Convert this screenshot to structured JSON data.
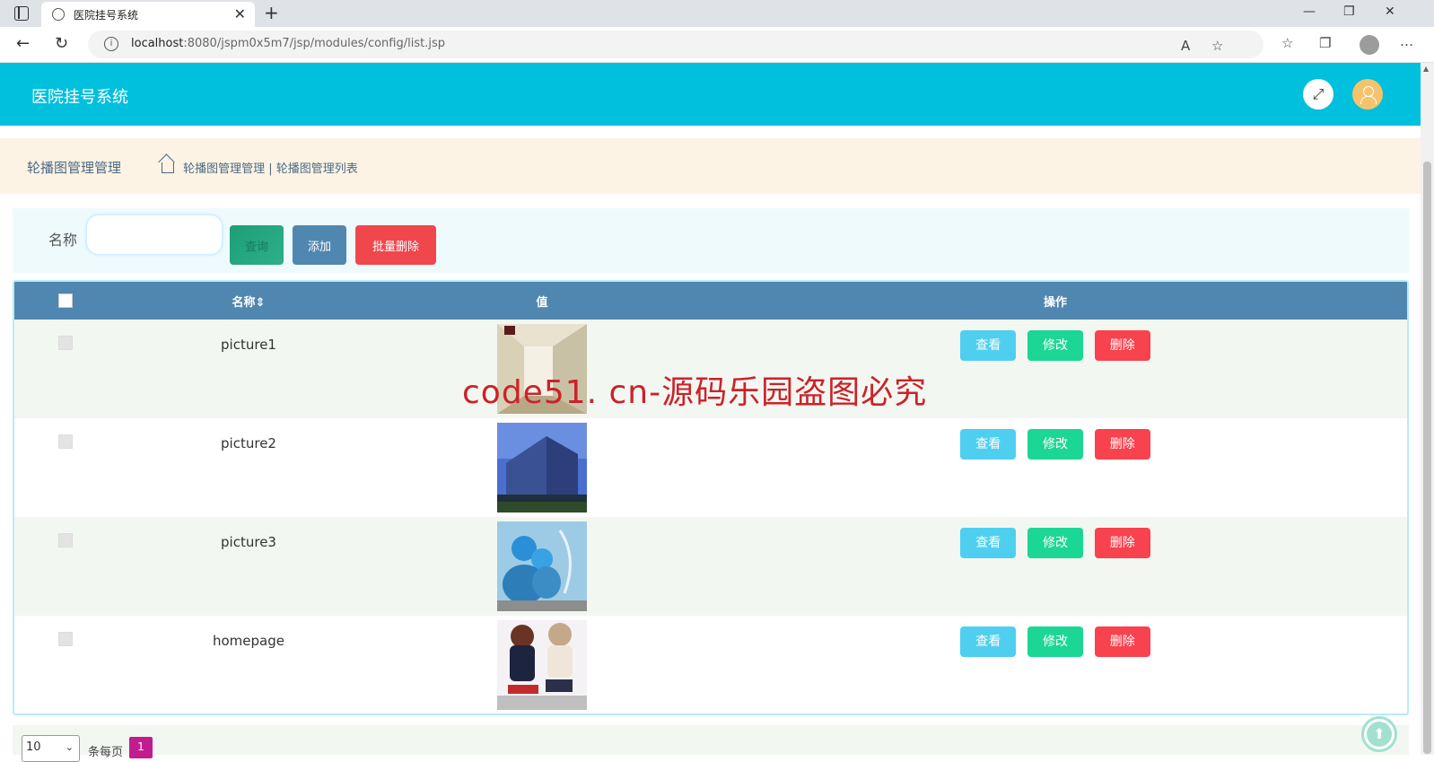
{
  "browser": {
    "tab_title": "医院挂号系统",
    "tab_close": "✕",
    "new_tab": "+",
    "url_host": "localhost",
    "url_rest": ":8080/jspm0x5m7/jsp/modules/config/list.jsp",
    "win_min": "—",
    "win_max": "❐",
    "win_close": "✕"
  },
  "header": {
    "title": "医院挂号系统",
    "expand_icon": "expand-icon",
    "user_icon": "user-icon"
  },
  "breadcrumb": {
    "title": "轮播图管理管理",
    "path": "轮播图管理管理 | 轮播图管理列表"
  },
  "search": {
    "label": "名称",
    "value": "",
    "query_button": "查询",
    "add_button": "添加",
    "batch_delete_button": "批量删除"
  },
  "table": {
    "columns": [
      "名称",
      "值",
      "操作"
    ],
    "sort_marker": "⇕",
    "rows": [
      {
        "name": "picture1",
        "image": "corridor"
      },
      {
        "name": "picture2",
        "image": "building"
      },
      {
        "name": "picture3",
        "image": "doctors"
      },
      {
        "name": "homepage",
        "image": "anime"
      }
    ],
    "view_label": "查看",
    "edit_label": "修改",
    "delete_label": "删除"
  },
  "watermark": "code51. cn-源码乐园盗图必究",
  "pager": {
    "page_size": "10",
    "per_page_label": "条每页",
    "current_page": "1"
  },
  "colors": {
    "header": "#00c0dd",
    "table_head": "#4f87b0",
    "view": "#4fcfef",
    "edit": "#1cd696",
    "delete": "#f8424e"
  }
}
